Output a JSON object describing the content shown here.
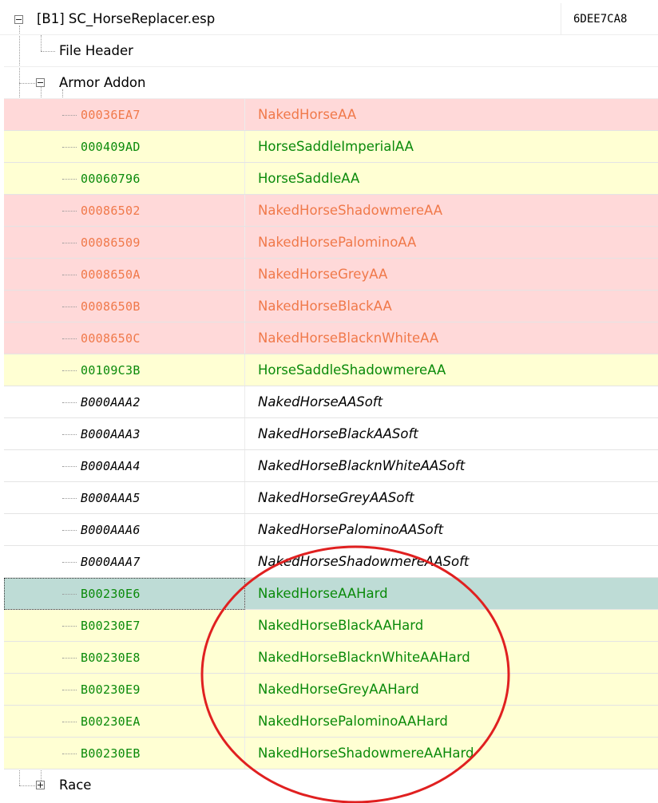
{
  "plugin": {
    "label": "[B1] SC_HorseReplacer.esp",
    "crc": "6DEE7CA8"
  },
  "file_header": {
    "label": "File Header"
  },
  "armor_addon": {
    "label": "Armor Addon",
    "records": [
      {
        "formid": "00036EA7",
        "edid": "NakedHorseAA",
        "state": "conflict"
      },
      {
        "formid": "000409AD",
        "edid": "HorseSaddleImperialAA",
        "state": "override"
      },
      {
        "formid": "00060796",
        "edid": "HorseSaddleAA",
        "state": "override"
      },
      {
        "formid": "00086502",
        "edid": "NakedHorseShadowmereAA",
        "state": "conflict"
      },
      {
        "formid": "00086509",
        "edid": "NakedHorsePalominoAA",
        "state": "conflict"
      },
      {
        "formid": "0008650A",
        "edid": "NakedHorseGreyAA",
        "state": "conflict"
      },
      {
        "formid": "0008650B",
        "edid": "NakedHorseBlackAA",
        "state": "conflict"
      },
      {
        "formid": "0008650C",
        "edid": "NakedHorseBlacknWhiteAA",
        "state": "conflict"
      },
      {
        "formid": "00109C3B",
        "edid": "HorseSaddleShadowmereAA",
        "state": "override"
      },
      {
        "formid": "B000AAA2",
        "edid": "NakedHorseAASoft",
        "state": "new"
      },
      {
        "formid": "B000AAA3",
        "edid": "NakedHorseBlackAASoft",
        "state": "new"
      },
      {
        "formid": "B000AAA4",
        "edid": "NakedHorseBlacknWhiteAASoft",
        "state": "new"
      },
      {
        "formid": "B000AAA5",
        "edid": "NakedHorseGreyAASoft",
        "state": "new"
      },
      {
        "formid": "B000AAA6",
        "edid": "NakedHorsePalominoAASoft",
        "state": "new"
      },
      {
        "formid": "B000AAA7",
        "edid": "NakedHorseShadowmereAASoft",
        "state": "new"
      },
      {
        "formid": "B00230E6",
        "edid": "NakedHorseAAHard",
        "state": "selected"
      },
      {
        "formid": "B00230E7",
        "edid": "NakedHorseBlackAAHard",
        "state": "override"
      },
      {
        "formid": "B00230E8",
        "edid": "NakedHorseBlacknWhiteAAHard",
        "state": "override"
      },
      {
        "formid": "B00230E9",
        "edid": "NakedHorseGreyAAHard",
        "state": "override"
      },
      {
        "formid": "B00230EA",
        "edid": "NakedHorsePalominoAAHard",
        "state": "override"
      },
      {
        "formid": "B00230EB",
        "edid": "NakedHorseShadowmereAAHard",
        "state": "override"
      }
    ]
  },
  "race": {
    "label": "Race"
  },
  "colors": {
    "conflict_bg": "#ffd9d9",
    "conflict_text": "#f0794a",
    "override_bg": "#ffffd3",
    "override_text": "#0a8a0a",
    "new_text": "#000000",
    "selected_bg": "#bedcd6",
    "annotation": "#e02020"
  },
  "icons": {
    "collapse": "minus-box-icon",
    "expand": "plus-box-icon"
  }
}
